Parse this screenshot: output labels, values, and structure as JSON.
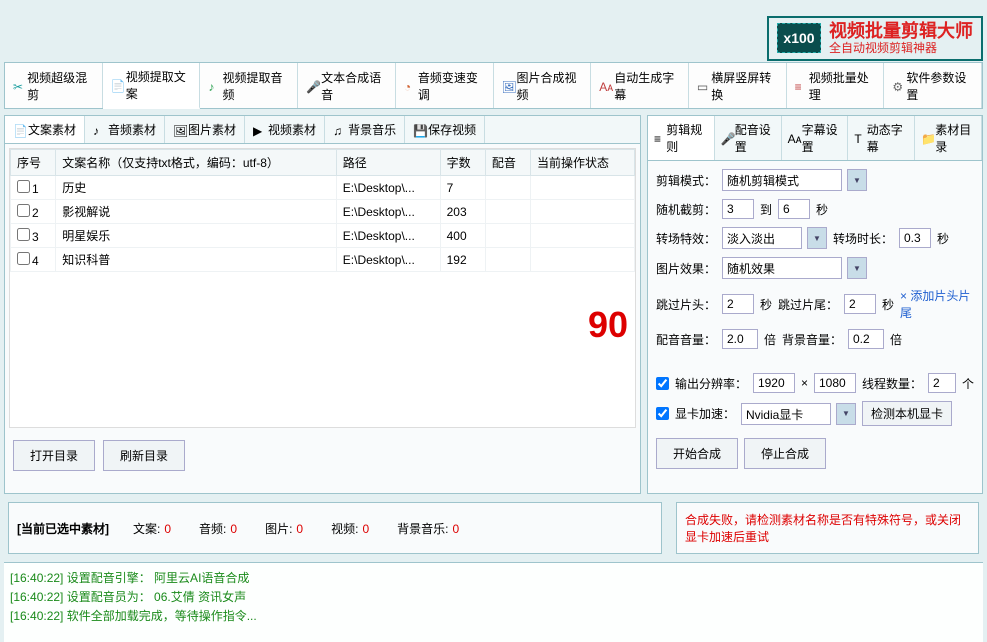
{
  "brand": {
    "logo": "x100",
    "title": "视频批量剪辑大师",
    "subtitle": "全自动视频剪辑神器"
  },
  "mainTabs": [
    {
      "label": "视频超级混剪",
      "icon": "✂"
    },
    {
      "label": "视频提取文案",
      "icon": "📄"
    },
    {
      "label": "视频提取音频",
      "icon": "♪"
    },
    {
      "label": "文本合成语音",
      "icon": "🎤"
    },
    {
      "label": "音频变速变调",
      "icon": "◔"
    },
    {
      "label": "图片合成视频",
      "icon": "🖼"
    },
    {
      "label": "自动生成字幕",
      "icon": "Aᴀ"
    },
    {
      "label": "横屏竖屏转换",
      "icon": "▭"
    },
    {
      "label": "视频批量处理",
      "icon": "≡"
    },
    {
      "label": "软件参数设置",
      "icon": "⚙"
    }
  ],
  "subTabs": [
    {
      "label": "文案素材",
      "icon": "📄"
    },
    {
      "label": "音频素材",
      "icon": "♪"
    },
    {
      "label": "图片素材",
      "icon": "🖼"
    },
    {
      "label": "视频素材",
      "icon": "▶"
    },
    {
      "label": "背景音乐",
      "icon": "♫"
    },
    {
      "label": "保存视频",
      "icon": "💾"
    }
  ],
  "table": {
    "headers": [
      "序号",
      "文案名称（仅支持txt格式，编码：utf-8）",
      "路径",
      "字数",
      "配音",
      "当前操作状态"
    ],
    "rows": [
      {
        "idx": "1",
        "name": "历史",
        "path": "E:\\Desktop\\...",
        "count": "7",
        "voice": "",
        "status": ""
      },
      {
        "idx": "2",
        "name": "影视解说",
        "path": "E:\\Desktop\\...",
        "count": "203",
        "voice": "",
        "status": ""
      },
      {
        "idx": "3",
        "name": "明星娱乐",
        "path": "E:\\Desktop\\...",
        "count": "400",
        "voice": "",
        "status": ""
      },
      {
        "idx": "4",
        "name": "知识科普",
        "path": "E:\\Desktop\\...",
        "count": "192",
        "voice": "",
        "status": ""
      }
    ]
  },
  "buttons": {
    "openDir": "打开目录",
    "refresh": "刷新目录"
  },
  "settingTabs": [
    {
      "label": "剪辑规则",
      "icon": "≡"
    },
    {
      "label": "配音设置",
      "icon": "🎤"
    },
    {
      "label": "字幕设置",
      "icon": "Aᴀ"
    },
    {
      "label": "动态字幕",
      "icon": "T"
    },
    {
      "label": "素材目录",
      "icon": "📁"
    }
  ],
  "settings": {
    "clipModeLabel": "剪辑模式：",
    "clipMode": "随机剪辑模式",
    "randCutLabel": "随机截剪：",
    "randFrom": "3",
    "randToLabel": "到",
    "randTo": "6",
    "sec": "秒",
    "transLabel": "转场特效：",
    "transMode": "淡入淡出",
    "transDurLabel": "转场时长：",
    "transDur": "0.3",
    "imgFxLabel": "图片效果：",
    "imgFx": "随机效果",
    "skipHeadLabel": "跳过片头：",
    "skipHead": "2",
    "skipTailLabel": "跳过片尾：",
    "skipTail": "2",
    "addHeadTail": "添加片头片尾",
    "voiceVolLabel": "配音音量：",
    "voiceVol": "2.0",
    "bgVolLabel": "背景音量：",
    "bgVol": "0.2",
    "times": "倍",
    "outResLabel": "输出分辨率：",
    "outW": "1920",
    "x": "×",
    "outH": "1080",
    "threadLabel": "线程数量：",
    "threads": "2",
    "unit": "个",
    "gpuLabel": "显卡加速：",
    "gpu": "Nvidia显卡",
    "detectGpu": "检测本机显卡",
    "start": "开始合成",
    "stop": "停止合成"
  },
  "overlay90": "90",
  "status": {
    "selected": "[当前已选中素材]",
    "items": [
      {
        "label": "文案:",
        "val": "0"
      },
      {
        "label": "音频:",
        "val": "0"
      },
      {
        "label": "图片:",
        "val": "0"
      },
      {
        "label": "视频:",
        "val": "0"
      },
      {
        "label": "背景音乐:",
        "val": "0"
      }
    ],
    "error": "合成失败，请检测素材名称是否有特殊符号，或关闭显卡加速后重试"
  },
  "logs": [
    {
      "ts": "[16:40:22]",
      "msg": "设置配音引擎： 阿里云AI语音合成"
    },
    {
      "ts": "[16:40:22]",
      "msg": "设置配音员为： 06.艾倩 资讯女声"
    },
    {
      "ts": "[16:40:22]",
      "msg": "软件全部加载完成，等待操作指令..."
    }
  ]
}
